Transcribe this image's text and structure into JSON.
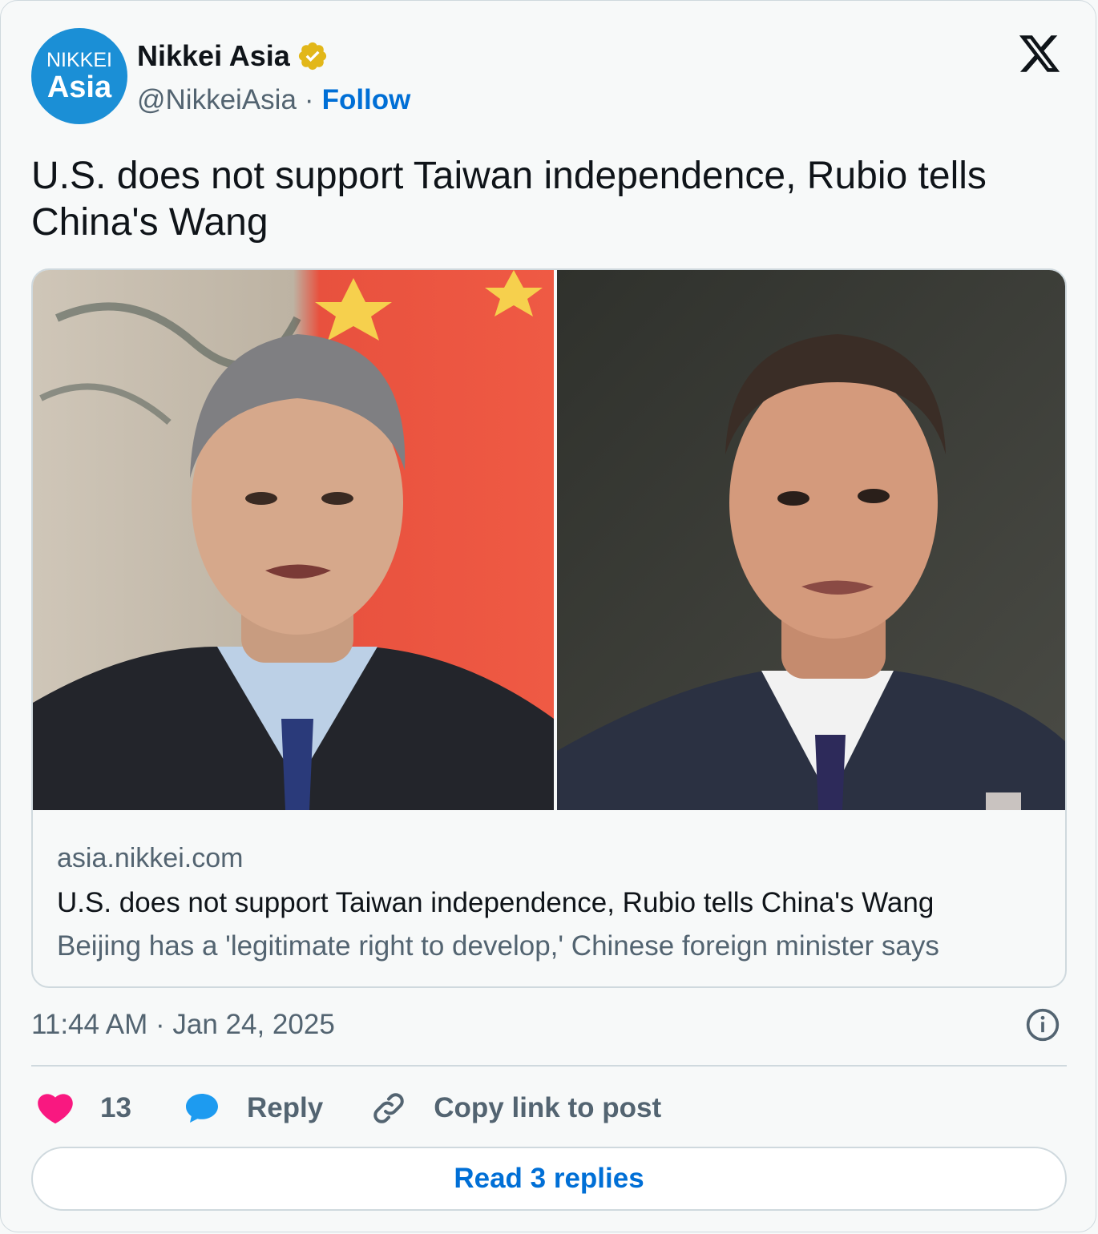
{
  "author": {
    "avatar_line1": "NIKKEI",
    "avatar_line2": "Asia",
    "name": "Nikkei Asia",
    "handle": "@NikkeiAsia",
    "separator": "·",
    "follow_label": "Follow",
    "verified_icon": "verified-badge-icon"
  },
  "platform_icon": "x-logo-icon",
  "tweet": {
    "text": "U.S. does not support Taiwan independence, Rubio tells China's Wang"
  },
  "link_card": {
    "domain": "asia.nikkei.com",
    "title": "U.S. does not support Taiwan independence, Rubio tells China's Wang",
    "description": "Beijing has a 'legitimate right to develop,' Chinese foreign minister says"
  },
  "timestamp": "11:44 AM · Jan 24, 2025",
  "actions": {
    "likes_count": "13",
    "reply_label": "Reply",
    "copy_label": "Copy link to post"
  },
  "read_replies_label": "Read 3 replies",
  "colors": {
    "accent": "#006fd6",
    "like": "#f91880",
    "reply": "#1d9bf0",
    "avatar": "#1b8fd6"
  }
}
